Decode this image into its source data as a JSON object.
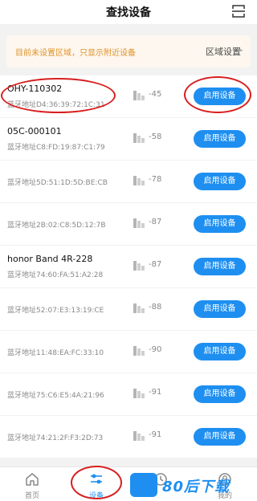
{
  "header": {
    "title": "查找设备"
  },
  "notice": {
    "message": "目前未设置区域，只显示附近设备",
    "region_label": "区域设置",
    "chevron": ">"
  },
  "devices": [
    {
      "name": "OHY-110302",
      "addr": "蓝牙地址D4:36:39:72:1C:31",
      "rssi": "-45",
      "button": "启用设备"
    },
    {
      "name": "05C-000101",
      "addr": "蓝牙地址C8:FD:19:87:C1:79",
      "rssi": "-58",
      "button": "启用设备"
    },
    {
      "name": "",
      "addr": "蓝牙地址5D:51:1D:5D:BE:CB",
      "rssi": "-78",
      "button": "启用设备"
    },
    {
      "name": "",
      "addr": "蓝牙地址2B:02:C8:5D:12:7B",
      "rssi": "-87",
      "button": "启用设备"
    },
    {
      "name": "honor Band 4R-228",
      "addr": "蓝牙地址74:60:FA:51:A2:28",
      "rssi": "-87",
      "button": "启用设备"
    },
    {
      "name": "",
      "addr": "蓝牙地址52:07:E3:13:19:CE",
      "rssi": "-88",
      "button": "启用设备"
    },
    {
      "name": "",
      "addr": "蓝牙地址11:48:EA:FC:33:10",
      "rssi": "-90",
      "button": "启用设备"
    },
    {
      "name": "",
      "addr": "蓝牙地址75:C6:E5:4A:21:96",
      "rssi": "-91",
      "button": "启用设备"
    },
    {
      "name": "",
      "addr": "蓝牙地址74:21:2F:F3:2D:73",
      "rssi": "-91",
      "button": "启用设备"
    }
  ],
  "tabs": [
    {
      "label": "首页",
      "icon": "home-icon"
    },
    {
      "label": "设备",
      "icon": "equalizer-icon"
    },
    {
      "label": "",
      "icon": "clock-icon"
    },
    {
      "label": "我的",
      "icon": "user-icon"
    }
  ],
  "watermark": {
    "text": "80后下载"
  },
  "colors": {
    "accent": "#1e8ff0",
    "notice_text": "#e0922a",
    "annotation": "#d81e1e"
  }
}
